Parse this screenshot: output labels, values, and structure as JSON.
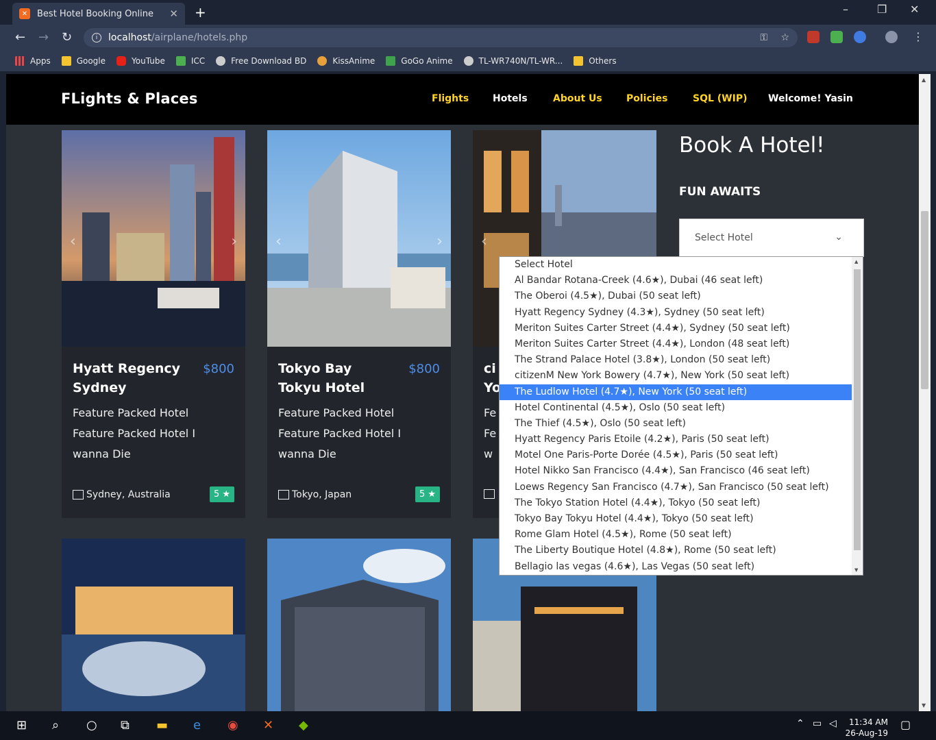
{
  "browser": {
    "tab_title": "Best Hotel Booking Online",
    "url_host": "localhost",
    "url_path": "/airplane/hotels.php",
    "bookmarks": [
      "Apps",
      "Google",
      "YouTube",
      "ICC",
      "Free Download BD",
      "KissAnime",
      "GoGo Anime",
      "TL-WR740N/TL-WR...",
      "Others"
    ]
  },
  "site": {
    "brand": "FLights & Places",
    "nav": {
      "flights": "Flights",
      "hotels": "Hotels",
      "about": "About Us",
      "policies": "Policies",
      "sql": "SQL (WIP)",
      "welcome": "Welcome! Yasin"
    },
    "colors": {
      "accent_yellow": "#ffd422",
      "price_blue": "#4e8ee8",
      "badge_green": "#28b485",
      "selected_blue": "#3b82f6"
    }
  },
  "cards": [
    {
      "name": "Hyatt Regency Sydney",
      "price": "$800",
      "desc": "Feature Packed Hotel Feature Packed Hotel I wanna Die",
      "location": "Sydney, Australia",
      "stars": "5 ★"
    },
    {
      "name": "Tokyo Bay Tokyu Hotel",
      "price": "$800",
      "desc": "Feature Packed Hotel Feature Packed Hotel I wanna Die",
      "location": "Tokyo, Japan",
      "stars": "5 ★"
    },
    {
      "name_partial_1": "ci",
      "name_partial_2": "Yo",
      "desc_partial_1": "Fe",
      "desc_partial_2": "Fe",
      "desc_partial_3": "w"
    }
  ],
  "sidebar": {
    "title": "Book A Hotel!",
    "subtitle": "FUN AWAITS",
    "select_value": "Select Hotel"
  },
  "dropdown": {
    "options": [
      "Select Hotel",
      "Al Bandar Rotana-Creek (4.6★), Dubai (46 seat left)",
      "The Oberoi (4.5★), Dubai (50 seat left)",
      "Hyatt Regency Sydney (4.3★), Sydney (50 seat left)",
      "Meriton Suites Carter Street (4.4★), Sydney (50 seat left)",
      "Meriton Suites Carter Street (4.4★), London (48 seat left)",
      "The Strand Palace Hotel (3.8★), London (50 seat left)",
      "citizenM New York Bowery (4.7★), New York (50 seat left)",
      "The Ludlow Hotel (4.7★), New York (50 seat left)",
      "Hotel Continental (4.5★), Oslo (50 seat left)",
      "The Thief (4.5★), Oslo (50 seat left)",
      "Hyatt Regency Paris Etoile (4.2★), Paris (50 seat left)",
      "Motel One Paris-Porte Dorée (4.5★), Paris (50 seat left)",
      "Hotel Nikko San Francisco (4.4★), San Francisco (46 seat left)",
      "Loews Regency San Francisco (4.7★), San Francisco (50 seat left)",
      "The Tokyo Station Hotel (4.4★), Tokyo (50 seat left)",
      "Tokyo Bay Tokyu Hotel (4.4★), Tokyo (50 seat left)",
      "Rome Glam Hotel (4.5★), Rome (50 seat left)",
      "The Liberty Boutique Hotel (4.8★), Rome (50 seat left)",
      "Bellagio las vegas (4.6★), Las Vegas (50 seat left)"
    ],
    "selected_index": 8
  },
  "taskbar": {
    "time": "11:34 AM",
    "date": "26-Aug-19"
  }
}
